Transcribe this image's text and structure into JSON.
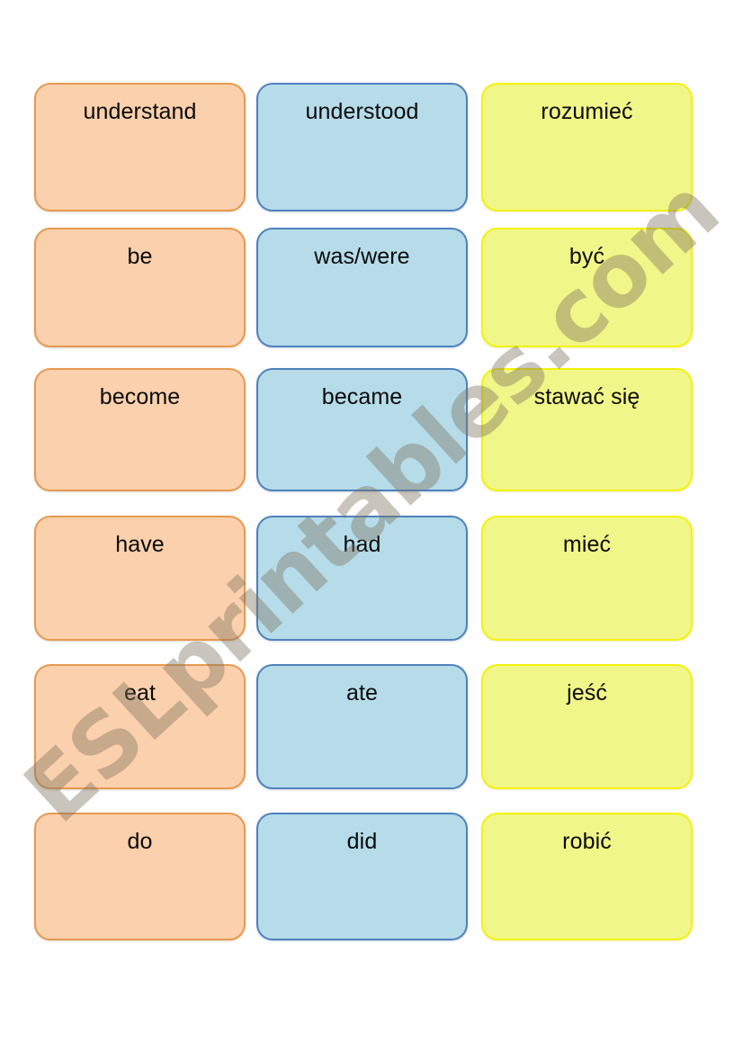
{
  "document": {
    "title": "Irregular verbs matching cards",
    "background_color": "#ffffff",
    "watermark_text": "ESLprintables.com"
  },
  "palette": {
    "infinitive_fill": "#FBD0AC",
    "infinitive_border": "#E69A50",
    "past_fill": "#B5DCE8",
    "past_border": "#4F81BD",
    "translation_fill": "#F1F689",
    "translation_border": "#F2F20A",
    "text_color": "#0a0a0a",
    "watermark_color": "#7E7360"
  },
  "columns": [
    {
      "key": "infinitive",
      "name": "infinitive-column"
    },
    {
      "key": "past",
      "name": "past-simple-column"
    },
    {
      "key": "translation",
      "name": "polish-translation-column"
    }
  ],
  "rows": [
    {
      "infinitive": "understand",
      "past": "understood",
      "translation": "rozumieć"
    },
    {
      "infinitive": "be",
      "past": "was/were",
      "translation": "być"
    },
    {
      "infinitive": "become",
      "past": "became",
      "translation": "stawać się"
    },
    {
      "infinitive": "have",
      "past": "had",
      "translation": "mieć"
    },
    {
      "infinitive": "eat",
      "past": "ate",
      "translation": "jeść"
    },
    {
      "infinitive": "do",
      "past": "did",
      "translation": "robić"
    }
  ]
}
